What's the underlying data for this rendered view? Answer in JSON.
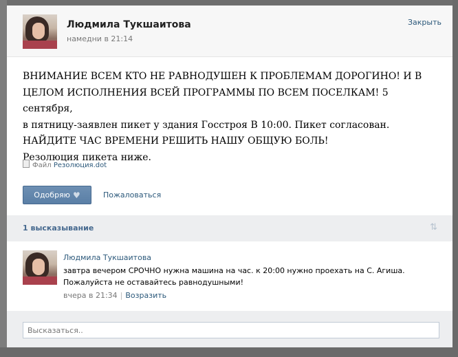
{
  "post": {
    "author": "Людмила Тукшаитова",
    "time": "намедни в 21:14",
    "close_label": "Закрыть",
    "text_lines": [
      "ВНИМАНИЕ ВСЕМ КТО НЕ РАВНОДУШЕН К ПРОБЛЕМАМ ДОРОГИНО! И В",
      "ЦЕЛОМ ИСПОЛНЕНИЯ ВСЕЙ ПРОГРАММЫ ПО ВСЕМ ПОСЕЛКАМ! 5 сентября,",
      "в пятницу-заявлен пикет у здания Госстроя В 10:00. Пикет согласован.",
      "НАЙДИТЕ ЧАС ВРЕМЕНИ РЕШИТЬ НАШУ ОБЩУЮ БОЛЬ!",
      "Резолюция пикета ниже."
    ],
    "file_prefix": "Файл",
    "file_name": "Резолюция.dot",
    "like_label": "Одобряю",
    "complain_label": "Пожаловаться"
  },
  "comments": {
    "count_label": "1 высказывание",
    "items": [
      {
        "author": "Людмила Тукшаитова",
        "text_lines": [
          "завтра вечером СРОЧНО нужна машина на час. к 20:00 нужно проехать на С. Агиша.",
          "Пожалуйста не оставайтесь равнодушными!"
        ],
        "time": "вчера в 21:34",
        "reply_label": "Возразить"
      }
    ]
  },
  "reply": {
    "placeholder": "Высказаться.."
  },
  "icons": {
    "heart": "heart-icon",
    "file": "file-icon",
    "sort": "sort-arrows-icon"
  },
  "colors": {
    "link": "#2b587a",
    "button": "#5a7fa6",
    "panel": "#edeef0"
  }
}
